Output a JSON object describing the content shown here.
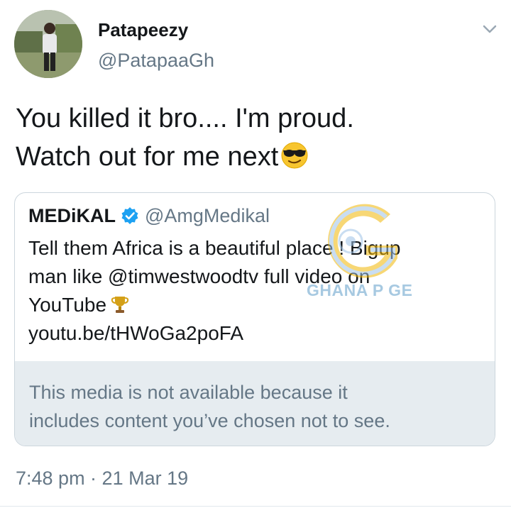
{
  "author": {
    "name": "Patapeezy",
    "handle": "@PatapaaGh"
  },
  "tweet": {
    "text_line1": "You killed it bro.... I'm proud.",
    "text_line2": "Watch out for me next",
    "emoji": "smiling-face-with-sunglasses"
  },
  "quoted_tweet": {
    "name": "MEDiKAL",
    "verified": true,
    "handle": "@AmgMedikal",
    "text_line1": "Tell them Africa is a beautiful place ! Bigup",
    "text_line2": "man like @timwestwoodtv full video on",
    "text_line3": "YouTube",
    "trophy_emoji": "trophy",
    "link": "youtu.be/tHWoGa2poFA",
    "media_notice_line1": "This media is not available because it",
    "media_notice_line2": "includes content you’ve chosen not to see."
  },
  "watermark": {
    "text": "GHANA P GE"
  },
  "timestamp": "7:48 pm · 21 Mar 19",
  "colors": {
    "text": "#14171a",
    "secondary": "#657786",
    "verified_blue": "#1da1f2",
    "media_bg": "#e6ecf0",
    "border": "#ccd6dd"
  }
}
